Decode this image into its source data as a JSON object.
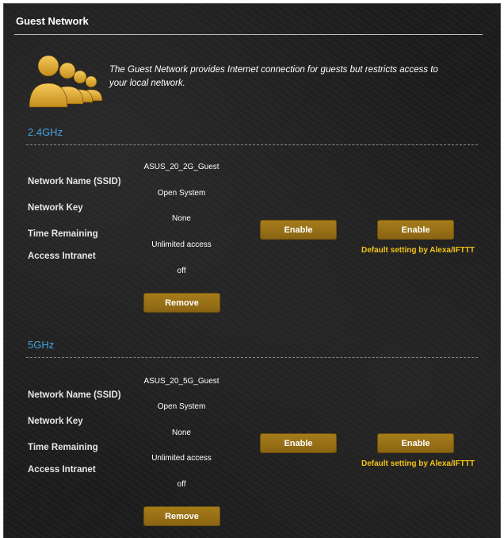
{
  "page": {
    "title": "Guest Network",
    "description": "The Guest Network provides Internet connection for guests but restricts access to your local network.",
    "icon": "guest-users-icon"
  },
  "colors": {
    "accent": "#9a711a",
    "band_title": "#45a4e0",
    "note": "#f2c318"
  },
  "labels": {
    "network_name": "Network Name (SSID)",
    "network_key": "Network Key",
    "time_remaining": "Time Remaining",
    "access_intranet": "Access Intranet"
  },
  "bands": [
    {
      "name": "2.4GHz",
      "ssid": "ASUS_20_2G_Guest",
      "auth": "Open System",
      "key": "None",
      "time": "Unlimited access",
      "intranet": "off",
      "remove_label": "Remove",
      "enable1_label": "Enable",
      "enable2_label": "Enable",
      "note": "Default setting by Alexa/IFTTT"
    },
    {
      "name": "5GHz",
      "ssid": "ASUS_20_5G_Guest",
      "auth": "Open System",
      "key": "None",
      "time": "Unlimited access",
      "intranet": "off",
      "remove_label": "Remove",
      "enable1_label": "Enable",
      "enable2_label": "Enable",
      "note": "Default setting by Alexa/IFTTT"
    }
  ]
}
